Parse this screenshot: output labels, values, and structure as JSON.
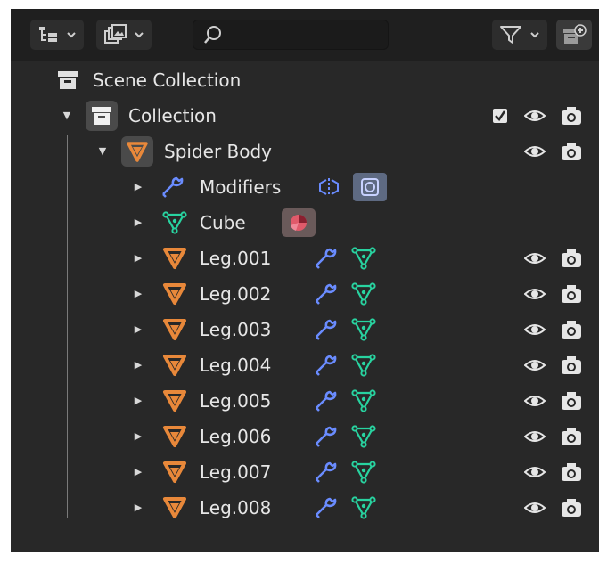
{
  "outliner": {
    "header": {
      "search_value": "",
      "icons": [
        "display-mode-icon",
        "filter-icon",
        "new-collection-icon",
        "search-icon",
        "chevron-down-icon"
      ]
    },
    "scene_collection": {
      "label": "Scene Collection"
    },
    "collection": {
      "label": "Collection",
      "checked": true
    },
    "object": {
      "label": "Spider Body"
    },
    "children": [
      {
        "label": "Modifiers"
      },
      {
        "label": "Cube"
      },
      {
        "label": "Leg.001"
      },
      {
        "label": "Leg.002"
      },
      {
        "label": "Leg.003"
      },
      {
        "label": "Leg.004"
      },
      {
        "label": "Leg.005"
      },
      {
        "label": "Leg.006"
      },
      {
        "label": "Leg.007"
      },
      {
        "label": "Leg.008"
      }
    ],
    "colors": {
      "panel_bg": "#282828",
      "header_bg": "#1f1f1f",
      "text": "#e6e6e6",
      "object_orange": "#e8883a",
      "mesh_green": "#28d3a0",
      "modifier_blue": "#6a8cff"
    }
  }
}
